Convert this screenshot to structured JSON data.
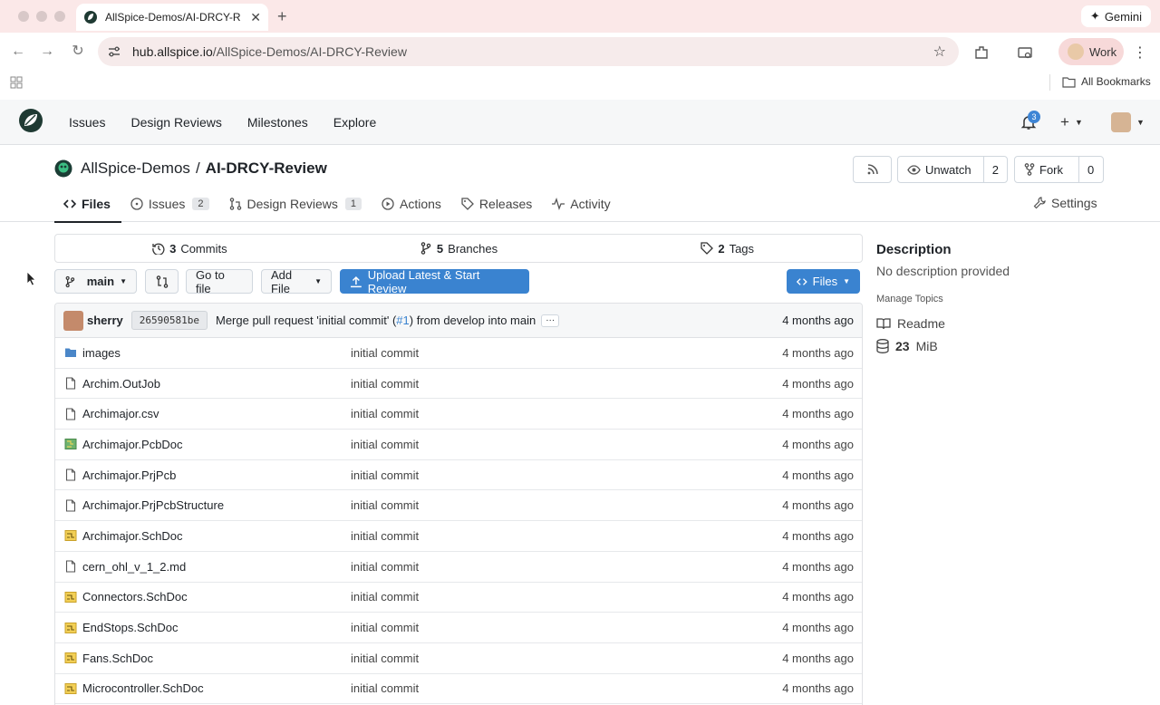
{
  "browser": {
    "tab_title": "AllSpice-Demos/AI-DRCY-Re",
    "gemini_label": "Gemini",
    "url_host": "hub.allspice.io",
    "url_path": "/AllSpice-Demos/AI-DRCY-Review",
    "profile_label": "Work",
    "all_bookmarks_label": "All Bookmarks"
  },
  "app_nav": {
    "items": [
      "Issues",
      "Design Reviews",
      "Milestones",
      "Explore"
    ],
    "notification_count": "3"
  },
  "repo": {
    "owner": "AllSpice-Demos",
    "separator": "/",
    "name": "AI-DRCY-Review",
    "watch_label": "Unwatch",
    "watch_count": "2",
    "fork_label": "Fork",
    "fork_count": "0",
    "tabs": [
      {
        "label": "Files"
      },
      {
        "label": "Issues",
        "badge": "2"
      },
      {
        "label": "Design Reviews",
        "badge": "1"
      },
      {
        "label": "Actions"
      },
      {
        "label": "Releases"
      },
      {
        "label": "Activity"
      }
    ],
    "settings_label": "Settings"
  },
  "stats": {
    "commits_count": "3",
    "commits_label": "Commits",
    "branches_count": "5",
    "branches_label": "Branches",
    "tags_count": "2",
    "tags_label": "Tags"
  },
  "actions": {
    "branch": "main",
    "go_to_file": "Go to file",
    "add_file": "Add File",
    "upload": "Upload Latest & Start Review",
    "files": "Files"
  },
  "latest_commit": {
    "user": "sherry",
    "sha": "26590581be",
    "msg_prefix": "Merge pull request 'initial commit' (",
    "msg_link": "#1",
    "msg_suffix": ") from develop into main",
    "ellipsis": "···",
    "time": "4 months ago"
  },
  "files": [
    {
      "name": "images",
      "icon": "folder-icon",
      "message": "initial commit",
      "time": "4 months ago"
    },
    {
      "name": "Archim.OutJob",
      "icon": "file-icon",
      "message": "initial commit",
      "time": "4 months ago"
    },
    {
      "name": "Archimajor.csv",
      "icon": "file-icon",
      "message": "initial commit",
      "time": "4 months ago"
    },
    {
      "name": "Archimajor.PcbDoc",
      "icon": "pcb-icon",
      "message": "initial commit",
      "time": "4 months ago"
    },
    {
      "name": "Archimajor.PrjPcb",
      "icon": "file-icon",
      "message": "initial commit",
      "time": "4 months ago"
    },
    {
      "name": "Archimajor.PrjPcbStructure",
      "icon": "file-icon",
      "message": "initial commit",
      "time": "4 months ago"
    },
    {
      "name": "Archimajor.SchDoc",
      "icon": "schematic-icon",
      "message": "initial commit",
      "time": "4 months ago"
    },
    {
      "name": "cern_ohl_v_1_2.md",
      "icon": "file-icon",
      "message": "initial commit",
      "time": "4 months ago"
    },
    {
      "name": "Connectors.SchDoc",
      "icon": "schematic-icon",
      "message": "initial commit",
      "time": "4 months ago"
    },
    {
      "name": "EndStops.SchDoc",
      "icon": "schematic-icon",
      "message": "initial commit",
      "time": "4 months ago"
    },
    {
      "name": "Fans.SchDoc",
      "icon": "schematic-icon",
      "message": "initial commit",
      "time": "4 months ago"
    },
    {
      "name": "Microcontroller.SchDoc",
      "icon": "schematic-icon",
      "message": "initial commit",
      "time": "4 months ago"
    }
  ],
  "sidebar": {
    "description_heading": "Description",
    "description": "No description provided",
    "manage_topics": "Manage Topics",
    "readme_label": "Readme",
    "size_value": "23",
    "size_unit": "MiB"
  },
  "colors": {
    "accent": "#3a83d0",
    "chrome_bg": "#fbe8e8",
    "folder": "#4a86c8",
    "schematic": "#e5b93a",
    "pcb": "#5aa05a"
  }
}
